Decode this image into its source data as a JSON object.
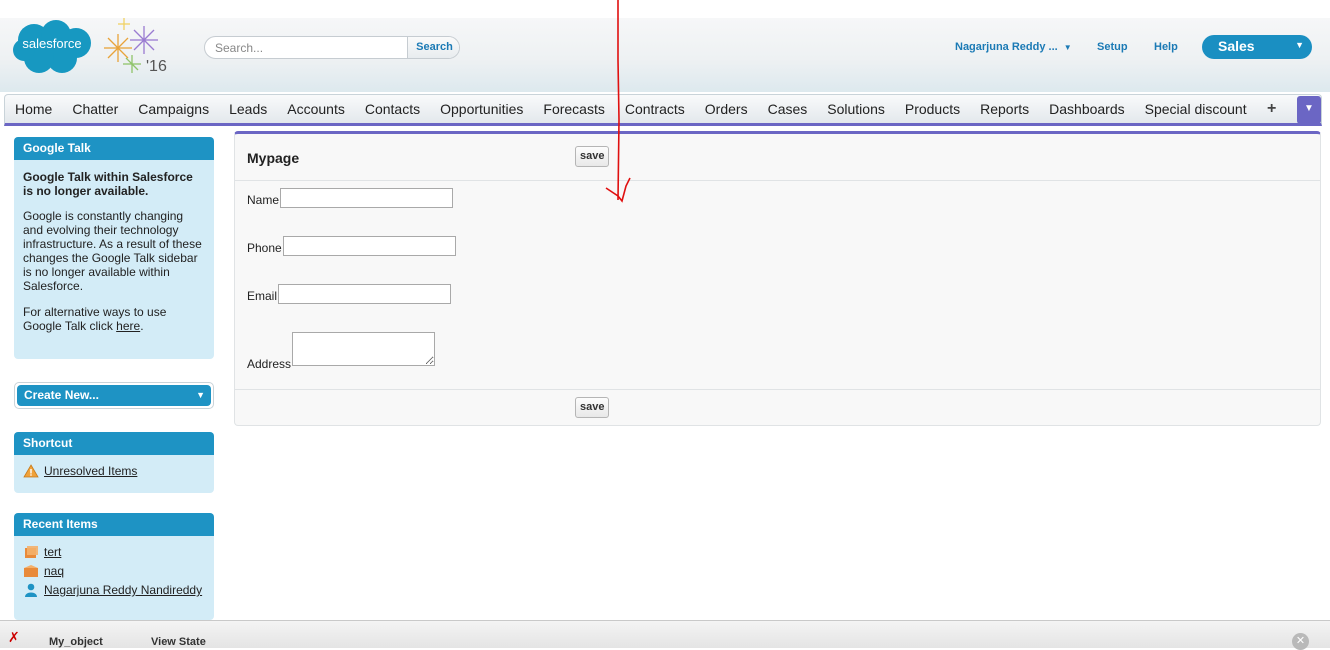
{
  "header": {
    "logo_text": "salesforce",
    "release_badge": "'16",
    "search": {
      "placeholder": "Search...",
      "button_label": "Search"
    },
    "user_menu_label": "Nagarjuna Reddy ...",
    "setup_label": "Setup",
    "help_label": "Help",
    "app_picker_label": "Sales"
  },
  "tabs": [
    "Home",
    "Chatter",
    "Campaigns",
    "Leads",
    "Accounts",
    "Contacts",
    "Opportunities",
    "Forecasts",
    "Contracts",
    "Orders",
    "Cases",
    "Solutions",
    "Products",
    "Reports",
    "Dashboards",
    "Special discount"
  ],
  "tab_plus_label": "+",
  "sidebar": {
    "google_talk": {
      "title": "Google Talk",
      "heading": "Google Talk within Salesforce is no longer available.",
      "body": "Google is constantly changing and evolving their technology infrastructure. As a result of these changes the Google Talk sidebar is no longer available within Salesforce.",
      "alt_prefix": "For alternative ways to use Google Talk click ",
      "alt_link": "here",
      "alt_suffix": "."
    },
    "create_new_label": "Create New...",
    "shortcut": {
      "title": "Shortcut",
      "items": [
        "Unresolved Items"
      ]
    },
    "recent": {
      "title": "Recent Items",
      "items": [
        "tert",
        "naq",
        "Nagarjuna Reddy Nandireddy"
      ]
    }
  },
  "page": {
    "title": "Mypage",
    "save_label": "save",
    "fields": {
      "name_label": "Name",
      "phone_label": "Phone",
      "email_label": "Email",
      "address_label": "Address"
    }
  },
  "dev_footer": {
    "tab1": "My_object",
    "tab2": "View State"
  },
  "colors": {
    "brand_blue": "#1e93c4",
    "tab_accent": "#6b66c4",
    "link_blue": "#1b7ab5",
    "annotation_red": "#e01010"
  }
}
